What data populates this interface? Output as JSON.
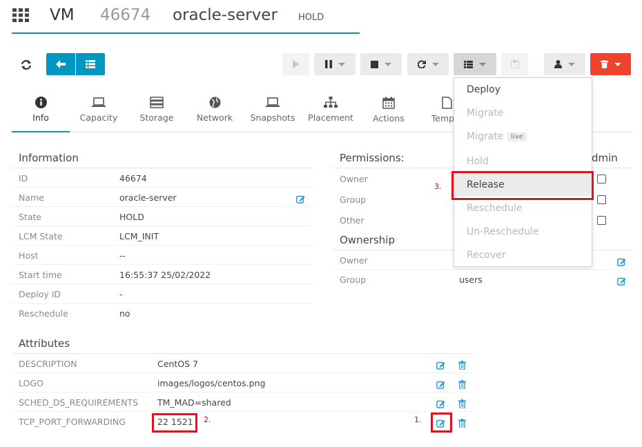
{
  "header": {
    "grid_icon": "grid-icon",
    "type": "VM",
    "id": "46674",
    "name": "oracle-server",
    "state": "HOLD"
  },
  "tabs": [
    {
      "label": "Info",
      "icon": "info-icon"
    },
    {
      "label": "Capacity",
      "icon": "laptop-icon"
    },
    {
      "label": "Storage",
      "icon": "storage-icon"
    },
    {
      "label": "Network",
      "icon": "globe-icon"
    },
    {
      "label": "Snapshots",
      "icon": "laptop-icon"
    },
    {
      "label": "Placement",
      "icon": "sitemap-icon"
    },
    {
      "label": "Actions",
      "icon": "calendar-icon"
    },
    {
      "label": "Templa",
      "icon": "file-icon"
    }
  ],
  "information": {
    "title": "Information",
    "rows": [
      {
        "label": "ID",
        "value": "46674"
      },
      {
        "label": "Name",
        "value": "oracle-server"
      },
      {
        "label": "State",
        "value": "HOLD"
      },
      {
        "label": "LCM State",
        "value": "LCM_INIT"
      },
      {
        "label": "Host",
        "value": "--"
      },
      {
        "label": "Start time",
        "value": "16:55:37 25/02/2022"
      },
      {
        "label": "Deploy ID",
        "value": "-"
      },
      {
        "label": "Reschedule",
        "value": "no"
      }
    ]
  },
  "attributes": {
    "title": "Attributes",
    "rows": [
      {
        "key": "DESCRIPTION",
        "value": "CentOS 7"
      },
      {
        "key": "LOGO",
        "value": "images/logos/centos.png"
      },
      {
        "key": "SCHED_DS_REQUIREMENTS",
        "value": "TM_MAD=shared"
      },
      {
        "key": "TCP_PORT_FORWARDING",
        "value": "22 1521"
      }
    ]
  },
  "permissions": {
    "title": "Permissions:",
    "admin_header": "dmin",
    "rows": [
      {
        "label": "Owner"
      },
      {
        "label": "Group"
      },
      {
        "label": "Other"
      }
    ]
  },
  "ownership": {
    "title": "Ownership",
    "rows": [
      {
        "label": "Owner",
        "value": ""
      },
      {
        "label": "Group",
        "value": "users"
      }
    ]
  },
  "dropdown_menu": {
    "items": [
      {
        "label": "Deploy",
        "enabled": true
      },
      {
        "label": "Migrate",
        "enabled": false
      },
      {
        "label": "Migrate",
        "enabled": false,
        "badge": "live"
      },
      {
        "label": "Hold",
        "enabled": false
      },
      {
        "label": "Release",
        "enabled": true,
        "highlighted": true
      },
      {
        "label": "Reschedule",
        "enabled": false
      },
      {
        "label": "Un-Reschedule",
        "enabled": false
      },
      {
        "label": "Recover",
        "enabled": false
      }
    ]
  },
  "annotations": {
    "step1": "1.",
    "step2": "2.",
    "step3": "3."
  },
  "colors": {
    "accent": "#0098c3",
    "danger": "#f0422d",
    "annotation": "#e0141e"
  }
}
